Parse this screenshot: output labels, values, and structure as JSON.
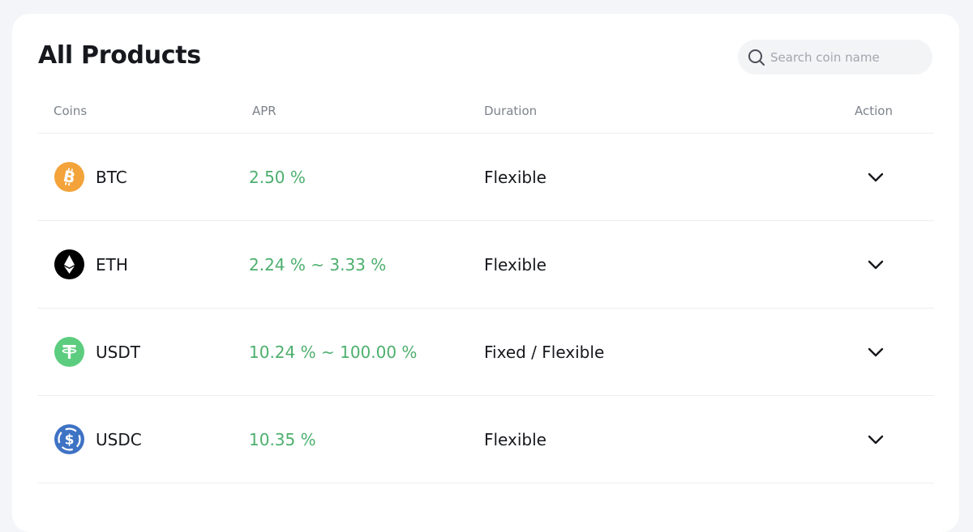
{
  "page": {
    "title": "All Products"
  },
  "search": {
    "placeholder": "Search coin name",
    "value": ""
  },
  "table": {
    "headers": {
      "coins": "Coins",
      "apr": "APR",
      "duration": "Duration",
      "action": "Action"
    },
    "rows": [
      {
        "coin": "BTC",
        "icon": "bitcoin-icon",
        "icon_color": "#f3a33a",
        "apr": "2.50 %",
        "duration": "Flexible",
        "action_icon": "chevron-down-icon"
      },
      {
        "coin": "ETH",
        "icon": "ethereum-icon",
        "icon_color": "#000000",
        "apr": "2.24 % ~ 3.33 %",
        "duration": "Flexible",
        "action_icon": "chevron-down-icon"
      },
      {
        "coin": "USDT",
        "icon": "tether-icon",
        "icon_color": "#5ccd7e",
        "apr": "10.24 % ~ 100.00 %",
        "duration": "Fixed / Flexible",
        "action_icon": "chevron-down-icon"
      },
      {
        "coin": "USDC",
        "icon": "usd-coin-icon",
        "icon_color": "#3e73c4",
        "apr": "10.35 %",
        "duration": "Flexible",
        "action_icon": "chevron-down-icon"
      }
    ]
  },
  "colors": {
    "apr_green": "#4daf6e",
    "header_gray": "#7d828b",
    "page_background": "#f4f5f8"
  }
}
